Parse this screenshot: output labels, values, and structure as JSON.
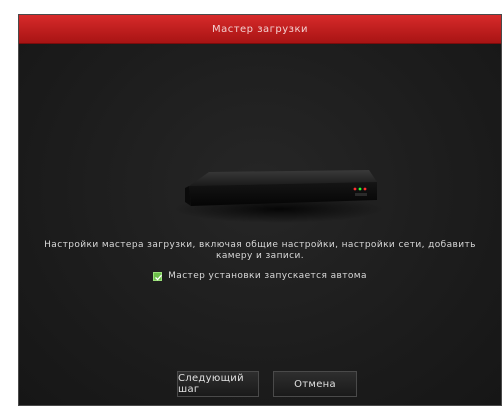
{
  "window": {
    "title": "Мастер загрузки"
  },
  "main": {
    "description": "Настройки мастера загрузки, включая общие настройки, настройки сети, добавить камеру и записи.",
    "autostart_checkbox": {
      "label": "Мастер установки запускается автома",
      "checked": true
    }
  },
  "buttons": {
    "next_label": "Следующий шаг",
    "cancel_label": "Отмена"
  },
  "colors": {
    "title_bar": "#c81e1e",
    "background": "#1e1e1e",
    "checkbox": "#6cc04a"
  },
  "icons": {
    "device": "nvr-device-icon",
    "check": "check-icon"
  }
}
